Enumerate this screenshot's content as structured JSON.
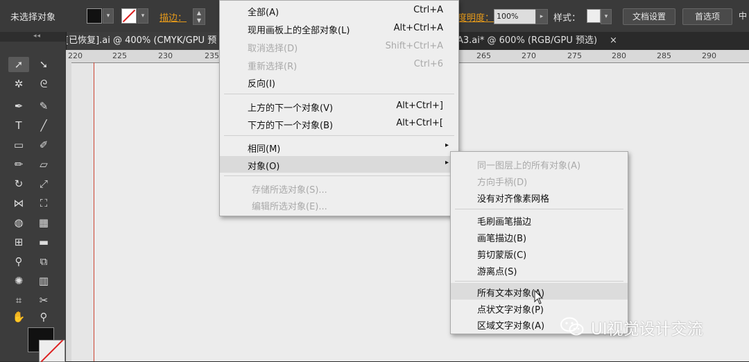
{
  "control_bar": {
    "selection_status": "未选择对象",
    "stroke_label": "描边：",
    "opacity_label": "度明度：",
    "opacity_value": "100%",
    "style_label": "样式：",
    "doc_setup_button": "文档设置",
    "preferences_button": "首选项",
    "extra_button": "中"
  },
  "toolbox": {
    "collapse_glyph": "◂◂"
  },
  "tabs": [
    {
      "label": "[已恢复].ai @ 400% (CMYK/GPU 预"
    },
    {
      "label": "A3.ai* @ 600% (RGB/GPU 预选)"
    }
  ],
  "tab_close": "×",
  "ruler_ticks": [
    "220",
    "225",
    "230",
    "235",
    "265",
    "270",
    "275",
    "280",
    "285",
    "290"
  ],
  "menu": {
    "items": [
      {
        "label": "全部(A)",
        "shortcut": "Ctrl+A",
        "disabled": false
      },
      {
        "label": "现用画板上的全部对象(L)",
        "shortcut": "Alt+Ctrl+A",
        "disabled": false
      },
      {
        "label": "取消选择(D)",
        "shortcut": "Shift+Ctrl+A",
        "disabled": true
      },
      {
        "label": "重新选择(R)",
        "shortcut": "Ctrl+6",
        "disabled": true
      },
      {
        "label": "反向(I)",
        "shortcut": "",
        "disabled": false
      },
      {
        "label": "上方的下一个对象(V)",
        "shortcut": "Alt+Ctrl+]",
        "disabled": false
      },
      {
        "label": "下方的下一个对象(B)",
        "shortcut": "Alt+Ctrl+[",
        "disabled": false
      },
      {
        "label": "相同(M)",
        "shortcut": "",
        "disabled": false
      },
      {
        "label": "对象(O)",
        "shortcut": "",
        "disabled": false
      },
      {
        "label": "存储所选对象(S)...",
        "shortcut": "",
        "disabled": true
      },
      {
        "label": "编辑所选对象(E)...",
        "shortcut": "",
        "disabled": true
      }
    ],
    "submenu_arrow": "▸"
  },
  "submenu": {
    "items": [
      {
        "label": "同一图层上的所有对象(A)",
        "disabled": true
      },
      {
        "label": "方向手柄(D)",
        "disabled": true
      },
      {
        "label": "没有对齐像素网格",
        "disabled": false
      },
      {
        "label": "毛刷画笔描边",
        "disabled": false
      },
      {
        "label": "画笔描边(B)",
        "disabled": false
      },
      {
        "label": "剪切蒙版(C)",
        "disabled": false
      },
      {
        "label": "游离点(S)",
        "disabled": false
      },
      {
        "label": "所有文本对象(A)",
        "disabled": false
      },
      {
        "label": "点状文字对象(P)",
        "disabled": false
      },
      {
        "label": "区域文字对象(A)",
        "disabled": false
      }
    ]
  },
  "watermark": {
    "text": "UI视觉设计交流"
  },
  "colors": {
    "accent": "#e69a1a",
    "stroke_none": "#dd2222",
    "menu_bg": "#eeeeee"
  }
}
